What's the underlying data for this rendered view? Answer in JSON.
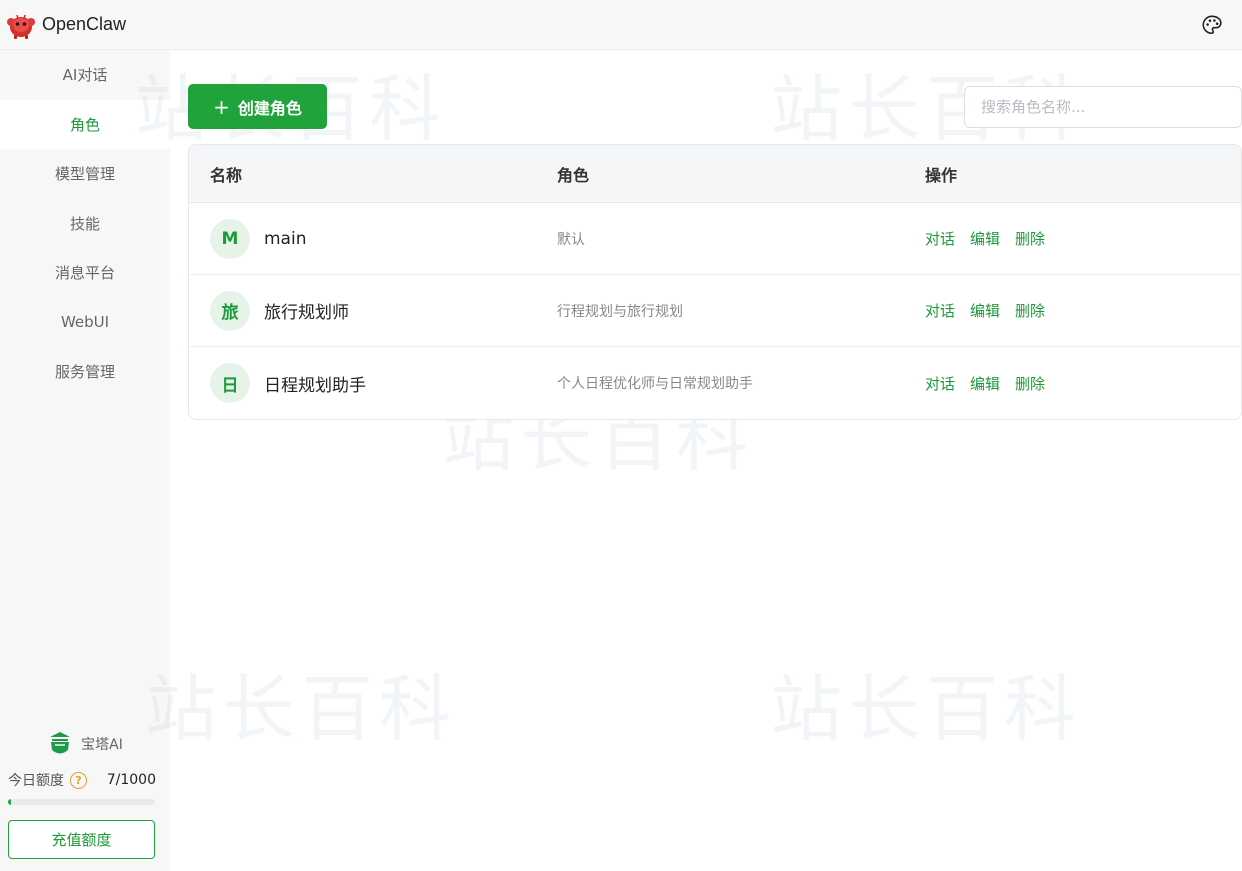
{
  "app": {
    "title": "OpenClaw"
  },
  "sidebar": {
    "items": [
      {
        "label": "AI对话",
        "active": false
      },
      {
        "label": "角色",
        "active": true
      },
      {
        "label": "模型管理",
        "active": false
      },
      {
        "label": "技能",
        "active": false
      },
      {
        "label": "消息平台",
        "active": false
      },
      {
        "label": "WebUI",
        "active": false
      },
      {
        "label": "服务管理",
        "active": false
      }
    ],
    "brand": "宝塔AI",
    "quota": {
      "label": "今日额度",
      "value": "7/1000",
      "used_fraction": 0.007
    },
    "recharge_label": "充值额度"
  },
  "toolbar": {
    "create_label": "创建角色",
    "search_placeholder": "搜索角色名称..."
  },
  "table": {
    "headers": {
      "name": "名称",
      "role": "角色",
      "ops": "操作"
    },
    "rows": [
      {
        "avatar": "M",
        "name": "main",
        "role": "默认"
      },
      {
        "avatar": "旅",
        "name": "旅行规划师",
        "role": "行程规划与旅行规划"
      },
      {
        "avatar": "日",
        "name": "日程规划助手",
        "role": "个人日程优化师与日常规划助手"
      }
    ],
    "ops": {
      "chat": "对话",
      "edit": "编辑",
      "delete": "删除"
    }
  },
  "colors": {
    "accent": "#20a33a",
    "accent_text": "#1d9a3a",
    "sidebar_bg": "#f7f7f8"
  }
}
